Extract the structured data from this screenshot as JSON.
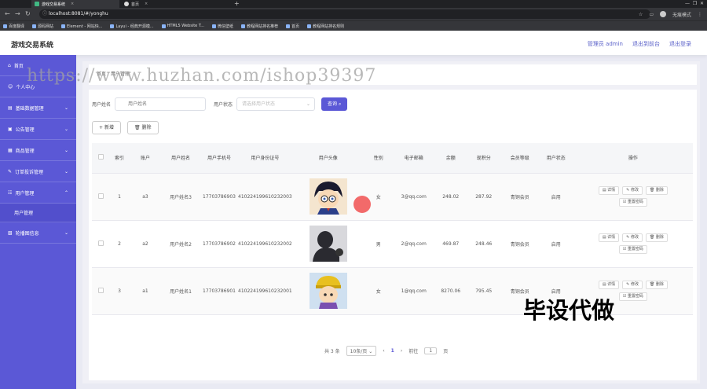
{
  "browser": {
    "tabs": [
      {
        "title": "游戏交易系统",
        "active": true
      },
      {
        "title": "首页",
        "active": false
      }
    ],
    "url": "localhost:8081/#/yonghu",
    "profile_label": "无痕模式",
    "bookmarks": [
      "百度翻译",
      "源码网站",
      "Element - 网站快...",
      "Layui - 经典开源模...",
      "HTML5 Website T...",
      "微信壁纸",
      "教程网站排名推荐",
      "首页",
      "教程网站排名规则"
    ]
  },
  "header": {
    "title": "游戏交易系统",
    "links": [
      "管理员 admin",
      "退出到前台",
      "退出登录"
    ]
  },
  "sidebar": {
    "items": [
      {
        "label": "首页",
        "icon": "home-icon"
      },
      {
        "label": "个人中心",
        "icon": "user-icon"
      },
      {
        "label": "基础数据管理",
        "icon": "data-icon"
      },
      {
        "label": "公告管理",
        "icon": "notice-icon"
      },
      {
        "label": "商品管理",
        "icon": "goods-icon"
      },
      {
        "label": "订单投诉管理",
        "icon": "order-icon"
      },
      {
        "label": "用户管理",
        "icon": "users-icon"
      },
      {
        "label": "轮播图信息",
        "icon": "image-icon"
      }
    ],
    "sub_item": "用户管理"
  },
  "breadcrumb": "首页 / 用户管理",
  "search": {
    "name_label": "用户姓名",
    "name_placeholder": "用户姓名",
    "status_label": "用户状态",
    "status_placeholder": "请选择用户状态",
    "query_button": "查询"
  },
  "actions": {
    "add": "新增",
    "delete": "删除"
  },
  "table": {
    "headers": [
      "索引",
      "账户",
      "用户姓名",
      "用户手机号",
      "用户身份证号",
      "用户头像",
      "性别",
      "电子邮箱",
      "余额",
      "现积分",
      "会员等级",
      "用户状态",
      "操作"
    ],
    "rows": [
      {
        "index": "1",
        "account": "a3",
        "name": "用户姓名3",
        "phone": "17703786903",
        "idcard": "410224199610232003",
        "gender": "女",
        "email": "3@qq.com",
        "balance": "248.02",
        "points": "287.92",
        "level": "青铜会员",
        "status": "启用"
      },
      {
        "index": "2",
        "account": "a2",
        "name": "用户姓名2",
        "phone": "17703786902",
        "idcard": "410224199610232002",
        "gender": "男",
        "email": "2@qq.com",
        "balance": "469.87",
        "points": "248.46",
        "level": "青铜会员",
        "status": "启用"
      },
      {
        "index": "3",
        "account": "a1",
        "name": "用户姓名1",
        "phone": "17703786901",
        "idcard": "410224199610232001",
        "gender": "女",
        "email": "1@qq.com",
        "balance": "8270.06",
        "points": "795.45",
        "level": "青铜会员",
        "status": "启用"
      }
    ],
    "op_labels": {
      "detail": "详情",
      "edit": "修改",
      "delete": "删除",
      "reset": "重置密码"
    }
  },
  "pagination": {
    "total": "共 3 条",
    "page_size": "10条/页",
    "current": "1",
    "goto_label": "前往",
    "goto_value": "1",
    "page_suffix": "页"
  },
  "overlay": {
    "watermark": "https://www.huzhan.com/ishop39397",
    "promo": "毕设代做"
  },
  "colors": {
    "accent": "#5b58d6",
    "header_link": "#5b62c9"
  }
}
